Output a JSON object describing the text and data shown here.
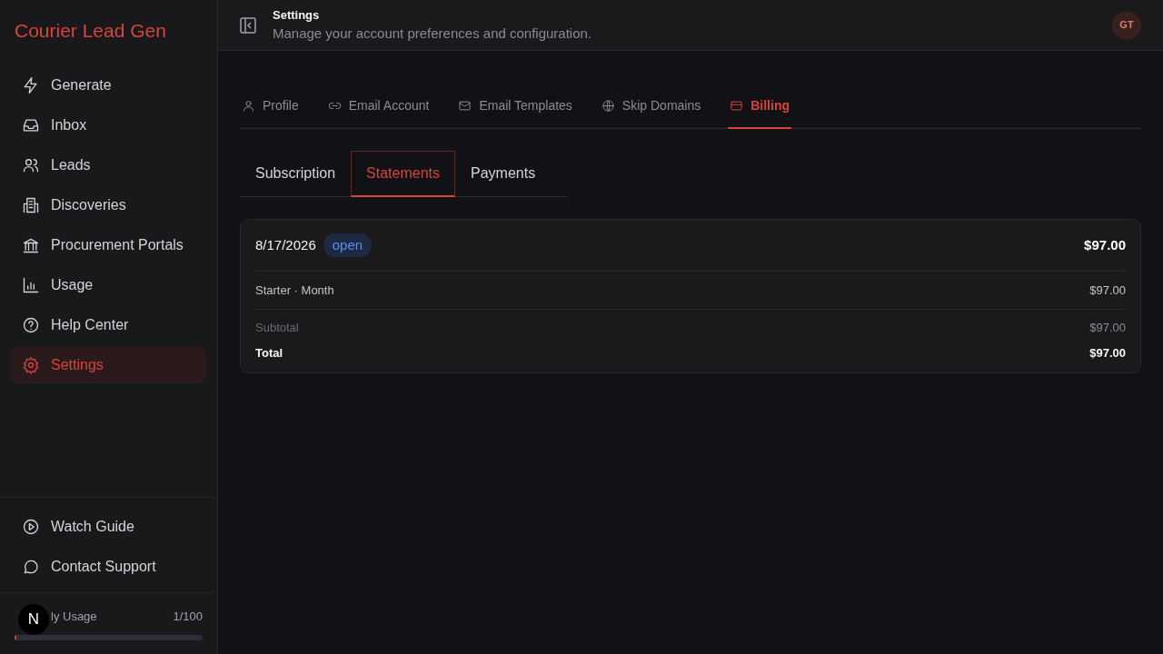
{
  "sidebar": {
    "brand": "Courier Lead Gen",
    "items": [
      {
        "label": "Generate",
        "selected": false
      },
      {
        "label": "Inbox",
        "selected": false
      },
      {
        "label": "Leads",
        "selected": false
      },
      {
        "label": "Discoveries",
        "selected": false
      },
      {
        "label": "Procurement Portals",
        "selected": false
      },
      {
        "label": "Usage",
        "selected": false
      },
      {
        "label": "Help Center",
        "selected": false
      },
      {
        "label": "Settings",
        "selected": true
      }
    ],
    "footer_items": [
      {
        "label": "Watch Guide"
      },
      {
        "label": "Contact Support"
      }
    ],
    "usage": {
      "label": "ly Usage",
      "reading": "1/100",
      "level": 0.01
    },
    "dev_badge": "N"
  },
  "header": {
    "title": "Settings",
    "subtitle": "Manage your account preferences and configuration.",
    "avatar": "GT"
  },
  "tabs": [
    {
      "label": "Profile",
      "selected": false
    },
    {
      "label": "Email Account",
      "selected": false
    },
    {
      "label": "Email Templates",
      "selected": false
    },
    {
      "label": "Skip Domains",
      "selected": false
    },
    {
      "label": "Billing",
      "selected": true
    }
  ],
  "subtabs": [
    {
      "label": "Subscription",
      "selected": false
    },
    {
      "label": "Statements",
      "selected": true
    },
    {
      "label": "Payments",
      "selected": false
    }
  ],
  "statement": {
    "date": "8/17/2026",
    "status": "open",
    "amount": "$97.00",
    "lines": [
      {
        "label": "Starter · Month",
        "amount": "$97.00"
      }
    ],
    "subtotal": {
      "label": "Subtotal",
      "amount": "$97.00"
    },
    "total": {
      "label": "Total",
      "amount": "$97.00"
    }
  }
}
